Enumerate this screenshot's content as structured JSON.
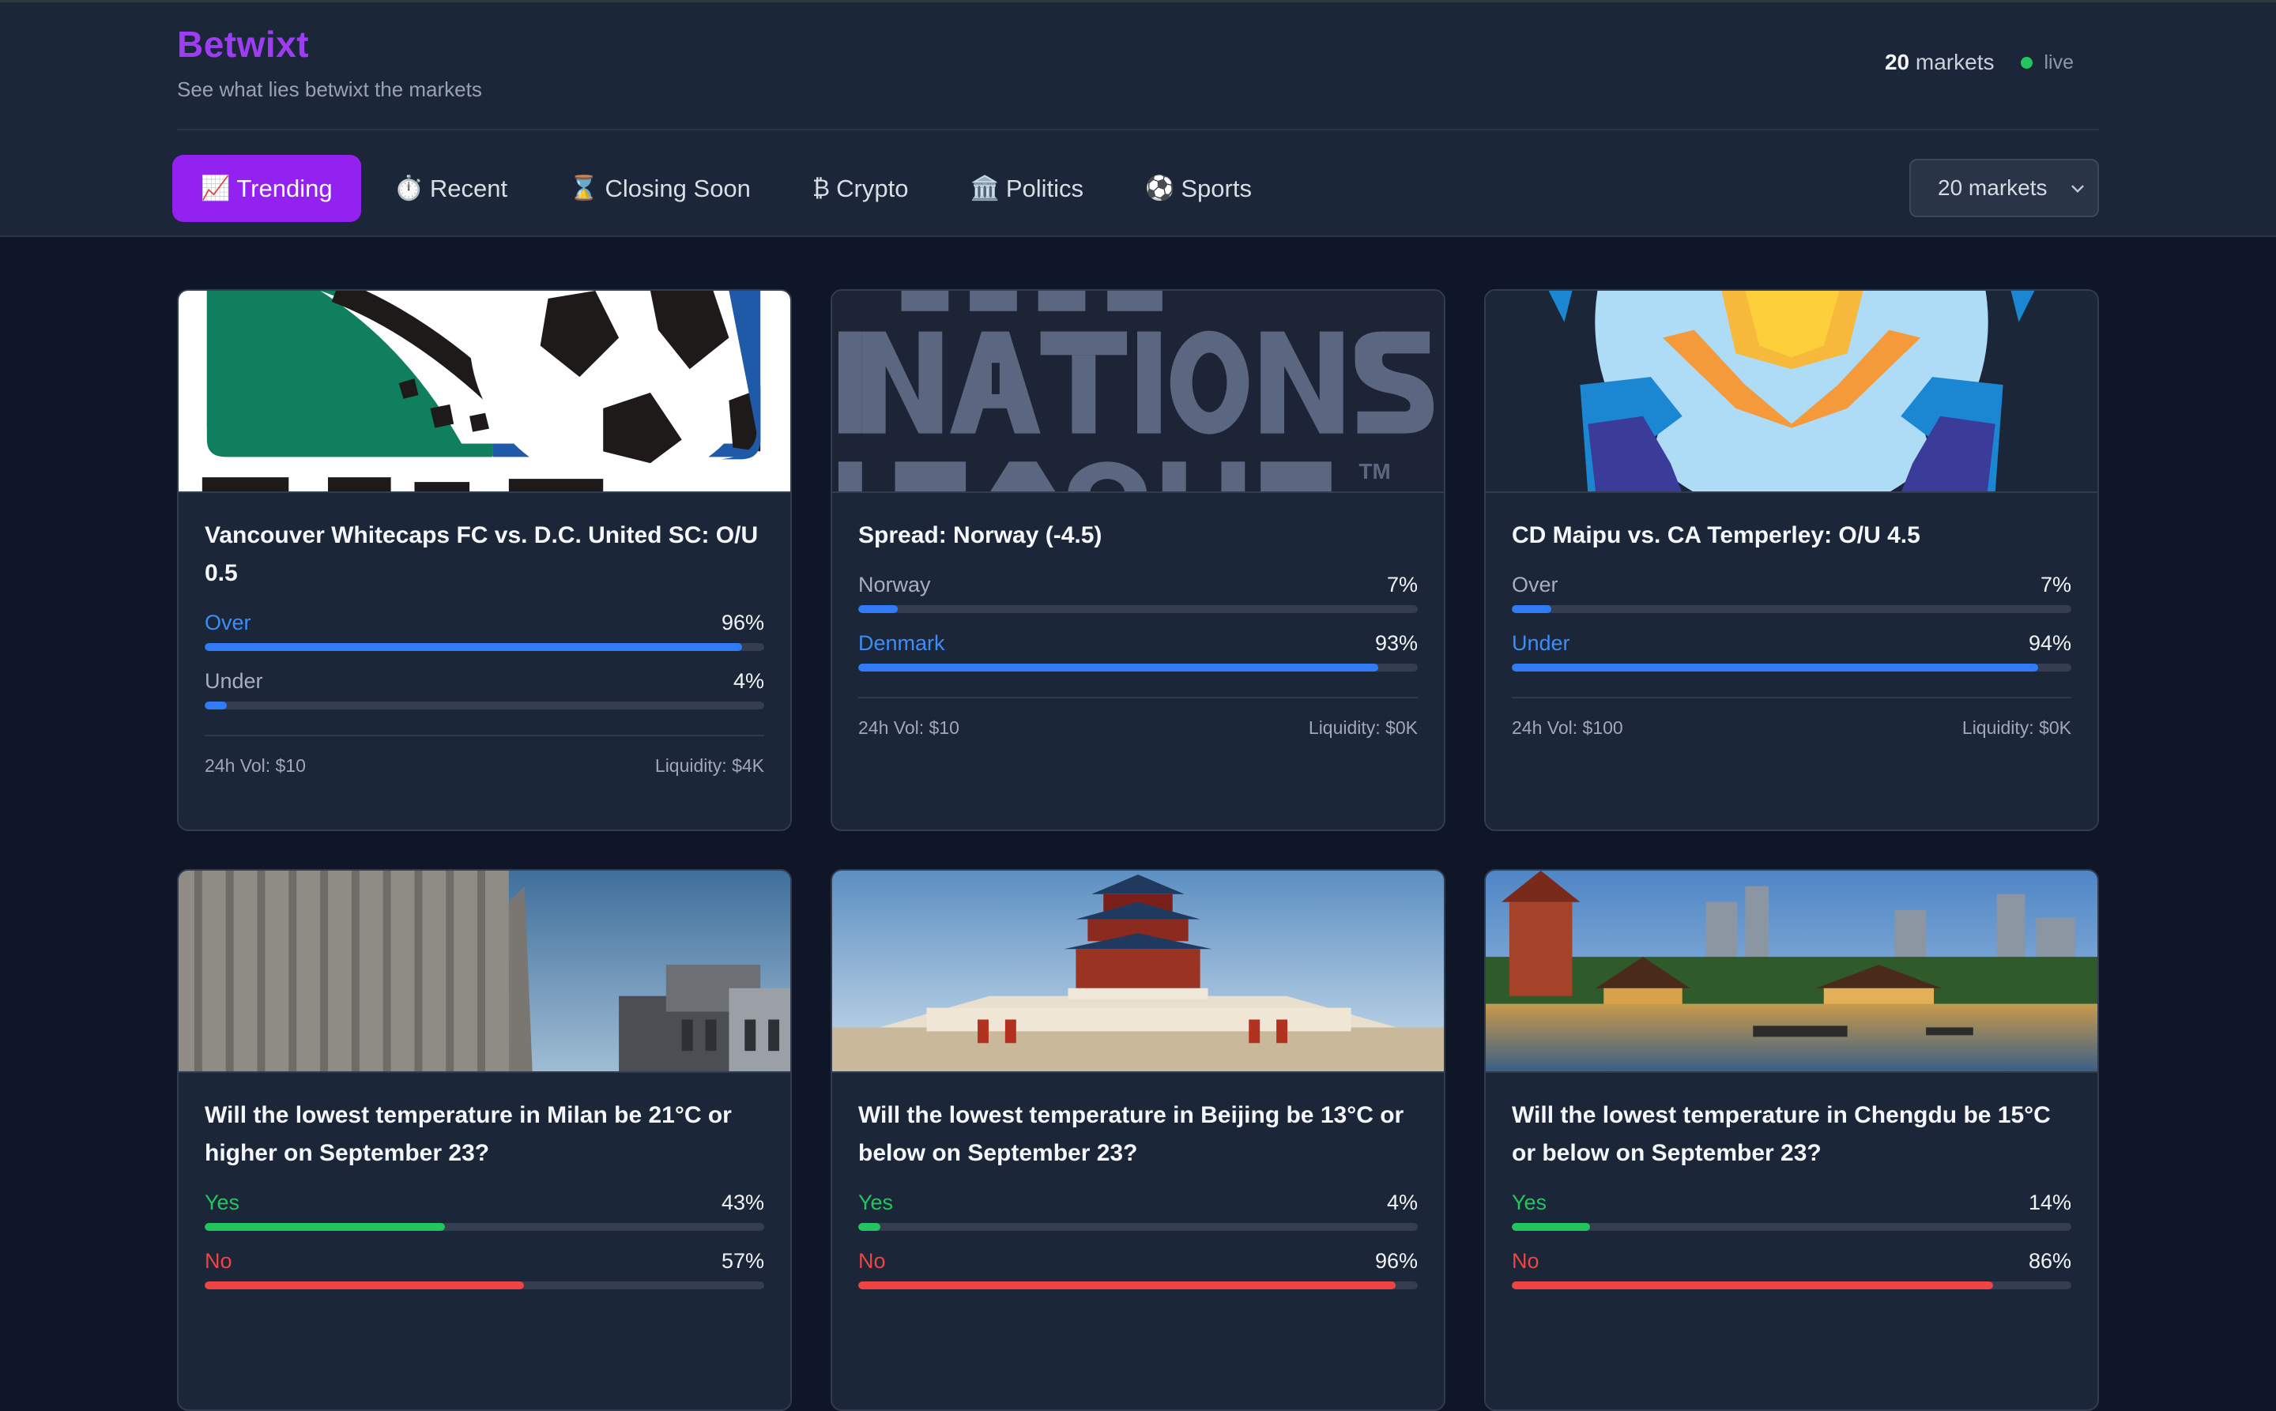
{
  "header": {
    "brand": "Betwixt",
    "tagline": "See what lies betwixt the markets",
    "market_count_number": "20",
    "market_count_label": "markets",
    "live_label": "live",
    "tabs": [
      {
        "icon": "📈",
        "label": "Trending",
        "active": true
      },
      {
        "icon": "⏱️",
        "label": "Recent",
        "active": false
      },
      {
        "icon": "⌛",
        "label": "Closing Soon",
        "active": false
      },
      {
        "icon": "₿",
        "label": "Crypto",
        "active": false
      },
      {
        "icon": "🏛️",
        "label": "Politics",
        "active": false
      },
      {
        "icon": "⚽",
        "label": "Sports",
        "active": false
      }
    ],
    "select_value": "20 markets"
  },
  "cards": [
    {
      "image": "mls-logo",
      "title": "Vancouver Whitecaps FC vs. D.C. United SC: O/U 0.5",
      "outcomes": [
        {
          "label": "Over",
          "pct": "96%",
          "value": 0.96,
          "lead": true
        },
        {
          "label": "Under",
          "pct": "4%",
          "value": 0.04,
          "lead": false
        }
      ],
      "volume": "24h Vol: $10",
      "liquidity": "Liquidity: $4K"
    },
    {
      "image": "nations-league-logo",
      "title": "Spread: Norway (-4.5)",
      "outcomes": [
        {
          "label": "Norway",
          "pct": "7%",
          "value": 0.07,
          "lead": false
        },
        {
          "label": "Denmark",
          "pct": "93%",
          "value": 0.93,
          "lead": true
        }
      ],
      "volume": "24h Vol: $10",
      "liquidity": "Liquidity: $0K"
    },
    {
      "image": "league-ball-logo",
      "title": "CD Maipu vs. CA Temperley: O/U 4.5",
      "outcomes": [
        {
          "label": "Over",
          "pct": "7%",
          "value": 0.07,
          "lead": false
        },
        {
          "label": "Under",
          "pct": "94%",
          "value": 0.94,
          "lead": true
        }
      ],
      "volume": "24h Vol: $100",
      "liquidity": "Liquidity: $0K"
    },
    {
      "image": "milan-cathedral-photo",
      "title": "Will the lowest temperature in Milan be 21°C or higher on September 23?",
      "outcomes": [
        {
          "label": "Yes",
          "pct": "43%",
          "value": 0.43,
          "kind": "yes"
        },
        {
          "label": "No",
          "pct": "57%",
          "value": 0.57,
          "kind": "no"
        }
      ]
    },
    {
      "image": "beijing-temple-photo",
      "title": "Will the lowest temperature in Beijing be 13°C or below on September 23?",
      "outcomes": [
        {
          "label": "Yes",
          "pct": "4%",
          "value": 0.04,
          "kind": "yes"
        },
        {
          "label": "No",
          "pct": "96%",
          "value": 0.96,
          "kind": "no"
        }
      ]
    },
    {
      "image": "chengdu-riverside-photo",
      "title": "Will the lowest temperature in Chengdu be 15°C or below on September 23?",
      "outcomes": [
        {
          "label": "Yes",
          "pct": "14%",
          "value": 0.14,
          "kind": "yes"
        },
        {
          "label": "No",
          "pct": "86%",
          "value": 0.86,
          "kind": "no"
        }
      ]
    }
  ],
  "colors": {
    "brand": "#9d3df2",
    "active_tab": "#9322f0",
    "lead_blue": "#3b8df8",
    "yes_green": "#22c55e",
    "no_red": "#ef4444"
  }
}
